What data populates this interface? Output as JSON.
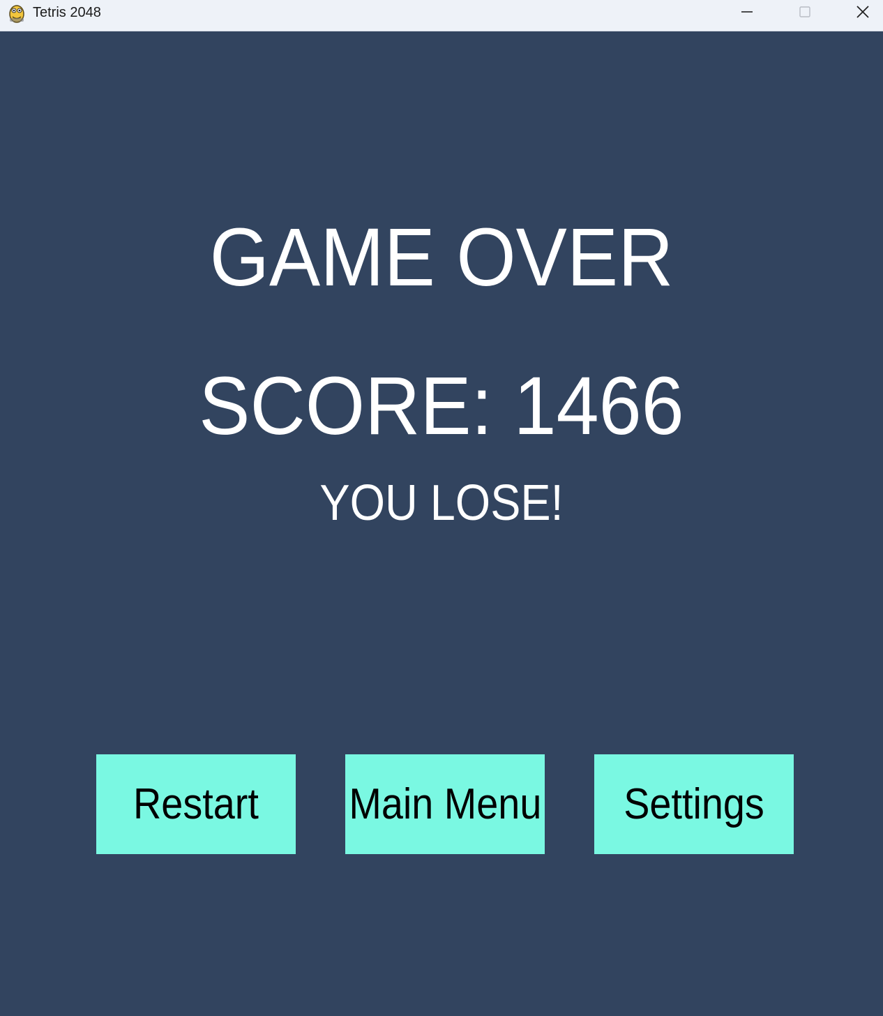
{
  "window": {
    "title": "Tetris 2048",
    "background": "#32445f",
    "titlebar_background": "#eef2f8",
    "controls": {
      "minimize_icon": "minimize-icon",
      "maximize_icon": "maximize-icon",
      "close_icon": "close-icon"
    }
  },
  "game_over": {
    "heading": "GAME OVER",
    "score_line": "SCORE: 1466",
    "result": "YOU LOSE!"
  },
  "buttons": {
    "restart_label": "Restart",
    "main_menu_label": "Main Menu",
    "settings_label": "Settings",
    "color": "#7af8e2"
  }
}
